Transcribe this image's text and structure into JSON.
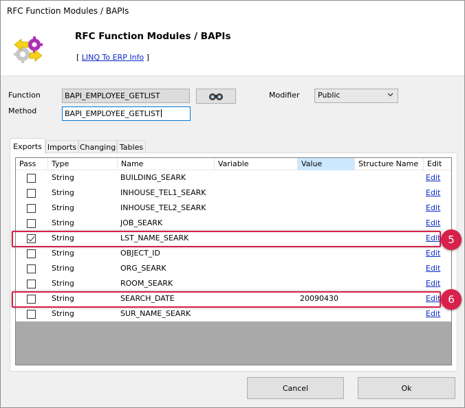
{
  "window": {
    "title": "RFC Function Modules / BAPIs"
  },
  "header": {
    "title": "RFC Function Modules / BAPIs",
    "link_prefix": "[",
    "link_text": "LINQ To ERP Info",
    "link_suffix": "]"
  },
  "form": {
    "function_label": "Function",
    "function_value": "BAPI_EMPLOYEE_GETLIST",
    "method_label": "Method",
    "method_value": "BAPI_EMPLOYEE_GETLIST",
    "modifier_label": "Modifier",
    "modifier_value": "Public"
  },
  "tabs": [
    {
      "label": "Exports",
      "selected": true
    },
    {
      "label": "Imports"
    },
    {
      "label": "Changing"
    },
    {
      "label": "Tables"
    }
  ],
  "grid": {
    "columns": [
      "Pass",
      "Type",
      "Name",
      "Variable",
      "Value",
      "Structure Name",
      "Edit"
    ],
    "rows": [
      {
        "pass": false,
        "type": "String",
        "name": "BUILDING_SEARK",
        "variable": "",
        "value": "",
        "structure": "",
        "edit": "Edit"
      },
      {
        "pass": false,
        "type": "String",
        "name": "INHOUSE_TEL1_SEARK",
        "variable": "",
        "value": "",
        "structure": "",
        "edit": "Edit"
      },
      {
        "pass": false,
        "type": "String",
        "name": "INHOUSE_TEL2_SEARK",
        "variable": "",
        "value": "",
        "structure": "",
        "edit": "Edit"
      },
      {
        "pass": false,
        "type": "String",
        "name": "JOB_SEARK",
        "variable": "",
        "value": "",
        "structure": "",
        "edit": "Edit"
      },
      {
        "pass": true,
        "type": "String",
        "name": "LST_NAME_SEARK",
        "variable": "",
        "value": "",
        "structure": "",
        "edit": "Edit"
      },
      {
        "pass": false,
        "type": "String",
        "name": "OBJECT_ID",
        "variable": "",
        "value": "",
        "structure": "",
        "edit": "Edit"
      },
      {
        "pass": false,
        "type": "String",
        "name": "ORG_SEARK",
        "variable": "",
        "value": "",
        "structure": "",
        "edit": "Edit"
      },
      {
        "pass": false,
        "type": "String",
        "name": "ROOM_SEARK",
        "variable": "",
        "value": "",
        "structure": "",
        "edit": "Edit"
      },
      {
        "pass": false,
        "type": "String",
        "name": "SEARCH_DATE",
        "variable": "",
        "value": "20090430",
        "structure": "",
        "edit": "Edit"
      },
      {
        "pass": false,
        "type": "String",
        "name": "SUR_NAME_SEARK",
        "variable": "",
        "value": "",
        "structure": "",
        "edit": "Edit"
      }
    ]
  },
  "callouts": [
    {
      "number": "5",
      "color": "#d7214a"
    },
    {
      "number": "6",
      "color": "#d7214a"
    }
  ],
  "buttons": {
    "cancel": "Cancel",
    "ok": "Ok"
  },
  "colors": {
    "accent_link": "#0b28c9",
    "callout": "#d7214a",
    "selected_header": "#cce8ff"
  }
}
